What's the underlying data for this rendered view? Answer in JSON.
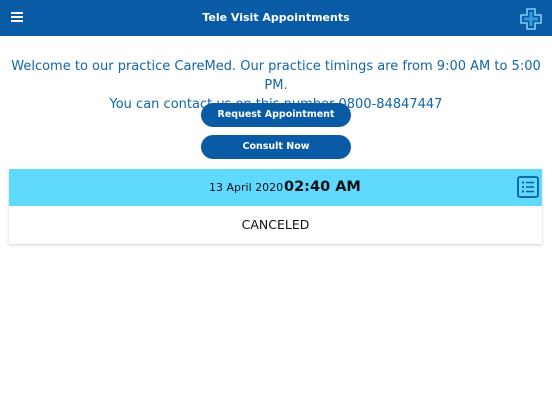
{
  "header": {
    "title": "Tele Visit Appointments",
    "menu_icon": "hamburger-menu-icon",
    "logo_icon": "medical-cross-logo-icon",
    "bar_color": "#0a5ba6"
  },
  "welcome": {
    "line1": "Welcome to our practice CareMed. Our practice timings are from 9:00 AM to 5:00 PM.",
    "line2": "You can contact us on this number 0800-84847447",
    "text_color": "#1266a8"
  },
  "actions": {
    "request_label": "Request Appointment",
    "consult_label": "Consult Now"
  },
  "appointment": {
    "date": "13 April 2020",
    "time": "02:40 AM",
    "status": "CANCELED",
    "details_icon": "list-details-icon",
    "header_color": "#5fd9fd"
  }
}
